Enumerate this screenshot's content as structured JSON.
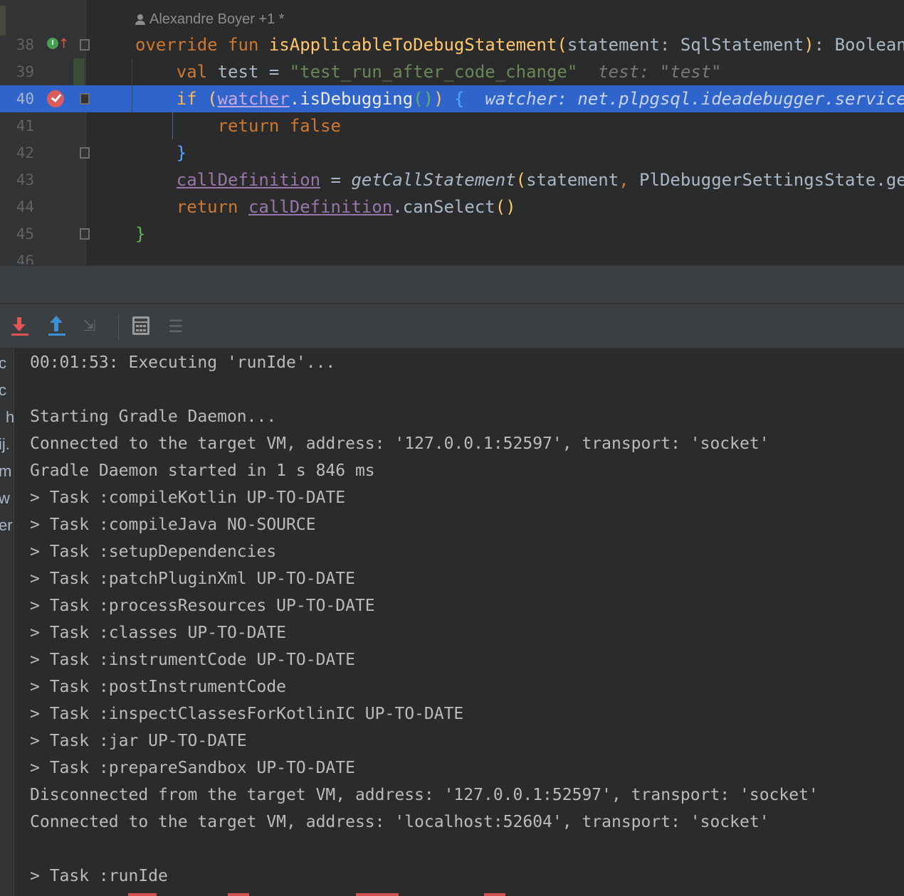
{
  "editor": {
    "author_annotation": "Alexandre Boyer +1 *",
    "lines": [
      {
        "num": "38",
        "tokens": [
          {
            "t": "override fun ",
            "c": "kw"
          },
          {
            "t": "isApplicableToDebugStatement",
            "c": "fn"
          },
          {
            "t": "(",
            "c": "brace-y"
          },
          {
            "t": "statement: SqlStatement",
            "c": ""
          },
          {
            "t": ")",
            "c": "brace-y"
          },
          {
            "t": ": Boolean",
            "c": ""
          }
        ]
      },
      {
        "num": "39",
        "tokens": [
          {
            "t": "    val ",
            "c": "kw"
          },
          {
            "t": "test = ",
            "c": ""
          },
          {
            "t": "\"test_run_after_code_change\"",
            "c": "str"
          },
          {
            "t": "  test: \"test\"",
            "c": "hint"
          }
        ]
      },
      {
        "num": "40",
        "tokens": [
          {
            "t": "    if ",
            "c": "kw"
          },
          {
            "t": "(",
            "c": "brace-y"
          },
          {
            "t": "watcher",
            "c": "prop"
          },
          {
            "t": ".isDebugging",
            "c": ""
          },
          {
            "t": "()",
            "c": "brace-g"
          },
          {
            "t": ")",
            "c": "brace-y"
          },
          {
            "t": " {",
            "c": "brace-b"
          },
          {
            "t": "  watcher: net.plpgsql.ideadebugger.service",
            "c": "hint"
          }
        ]
      },
      {
        "num": "41",
        "tokens": [
          {
            "t": "        return false",
            "c": "kw"
          }
        ]
      },
      {
        "num": "42",
        "tokens": [
          {
            "t": "    }",
            "c": "brace-b"
          }
        ]
      },
      {
        "num": "43",
        "tokens": [
          {
            "t": "    ",
            "c": ""
          },
          {
            "t": "callDefinition",
            "c": "prop"
          },
          {
            "t": " = ",
            "c": ""
          },
          {
            "t": "getCallStatement",
            "c": "ital"
          },
          {
            "t": "(",
            "c": "brace-y"
          },
          {
            "t": "statement",
            "c": ""
          },
          {
            "t": ", ",
            "c": "kw"
          },
          {
            "t": "PlDebuggerSettingsState.ge",
            "c": ""
          }
        ]
      },
      {
        "num": "44",
        "tokens": [
          {
            "t": "    return ",
            "c": "kw"
          },
          {
            "t": "callDefinition",
            "c": "prop"
          },
          {
            "t": ".canSelect",
            "c": ""
          },
          {
            "t": "()",
            "c": "brace-y"
          }
        ]
      },
      {
        "num": "45",
        "tokens": [
          {
            "t": "}",
            "c": "brace-g"
          }
        ]
      },
      {
        "num": "46",
        "tokens": []
      }
    ]
  },
  "toolbar": {
    "buttons": [
      {
        "name": "scroll-to-end-button",
        "icon": "download-arrow-icon"
      },
      {
        "name": "scroll-up-button",
        "icon": "upload-arrow-icon"
      },
      {
        "name": "move-caret-button",
        "icon": "caret-move-icon"
      },
      {
        "name": "table-view-button",
        "icon": "calculator-icon"
      },
      {
        "name": "soft-wrap-button",
        "icon": "soft-wrap-icon"
      }
    ]
  },
  "console": {
    "left_cut_chars": [
      "c",
      "c",
      "h",
      "ij.",
      "m",
      "w",
      "er"
    ],
    "lines": [
      "00:01:53: Executing 'runIde'...",
      "",
      "Starting Gradle Daemon...",
      "Connected to the target VM, address: '127.0.0.1:52597', transport: 'socket'",
      "Gradle Daemon started in 1 s 846 ms",
      "> Task :compileKotlin UP-TO-DATE",
      "> Task :compileJava NO-SOURCE",
      "> Task :setupDependencies",
      "> Task :patchPluginXml UP-TO-DATE",
      "> Task :processResources UP-TO-DATE",
      "> Task :classes UP-TO-DATE",
      "> Task :instrumentCode UP-TO-DATE",
      "> Task :postInstrumentCode",
      "> Task :inspectClassesForKotlinIC UP-TO-DATE",
      "> Task :jar UP-TO-DATE",
      "> Task :prepareSandbox UP-TO-DATE",
      "Disconnected from the target VM, address: '127.0.0.1:52597', transport: 'socket'",
      "Connected to the target VM, address: 'localhost:52604', transport: 'socket'",
      "",
      "> Task :runIde"
    ]
  },
  "colors": {
    "editor_bg": "#2b2b2b",
    "current_line": "#2f65ca",
    "keyword": "#cc7832",
    "function": "#ffc66d",
    "string": "#6a8759",
    "property": "#9876aa",
    "console_text": "#bbbbbb"
  }
}
